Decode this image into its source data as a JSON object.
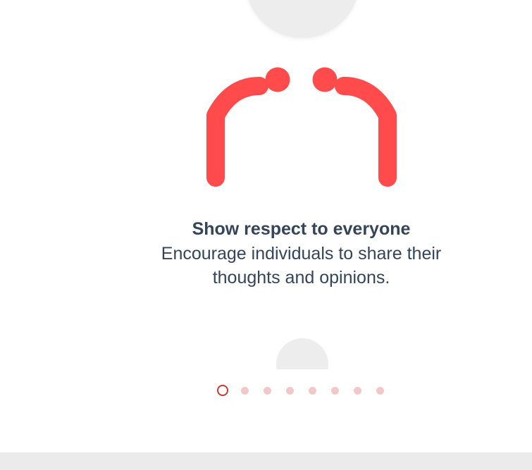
{
  "slide": {
    "title": "Show respect to everyone",
    "description_line1": "Encourage individuals to share their",
    "description_line2": "thoughts and opinions.",
    "illustration_icon": "bowing-figures-icon"
  },
  "carousel": {
    "total_slides": 8,
    "active_index": 0,
    "active_color": "#c93a33",
    "inactive_color": "#f1c7c7"
  },
  "colors": {
    "accent": "#ff4b4b",
    "text": "#34455a",
    "bubble": "#ededed"
  }
}
